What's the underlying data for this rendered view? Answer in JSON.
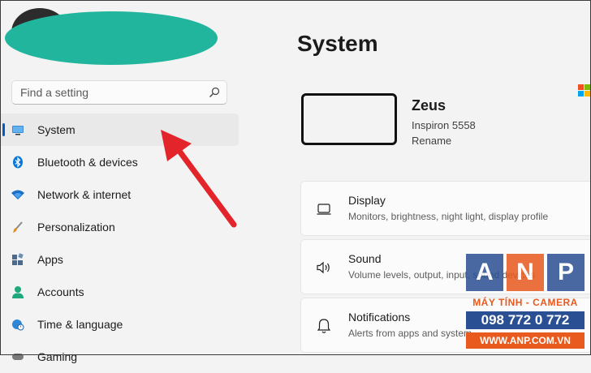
{
  "search": {
    "placeholder": "Find a setting"
  },
  "sidebar": {
    "items": [
      {
        "label": "System",
        "icon": "monitor-icon",
        "selected": true
      },
      {
        "label": "Bluetooth & devices",
        "icon": "bluetooth-icon"
      },
      {
        "label": "Network & internet",
        "icon": "wifi-icon"
      },
      {
        "label": "Personalization",
        "icon": "brush-icon"
      },
      {
        "label": "Apps",
        "icon": "apps-icon"
      },
      {
        "label": "Accounts",
        "icon": "person-icon"
      },
      {
        "label": "Time & language",
        "icon": "globe-clock-icon"
      },
      {
        "label": "Gaming",
        "icon": "gamepad-icon"
      }
    ]
  },
  "main": {
    "title": "System",
    "device": {
      "name": "Zeus",
      "model": "Inspiron 5558",
      "rename": "Rename"
    },
    "cards": [
      {
        "title": "Display",
        "subtitle": "Monitors, brightness, night light, display profile",
        "icon": "display-icon"
      },
      {
        "title": "Sound",
        "subtitle": "Volume levels, output, input, sound devices",
        "icon": "speaker-icon"
      },
      {
        "title": "Notifications",
        "subtitle": "Alerts from apps and system",
        "icon": "bell-icon"
      }
    ]
  },
  "watermark": {
    "letters": [
      "A",
      "N",
      "P"
    ],
    "line1": "MÁY TÍNH - CAMERA",
    "phone": "098 772 0 772",
    "site": "WWW.ANP.COM.VN"
  },
  "colors": {
    "accent": "#005fb8",
    "annotation_arrow": "#e3242b",
    "avatar_blur": "#20b59c"
  }
}
